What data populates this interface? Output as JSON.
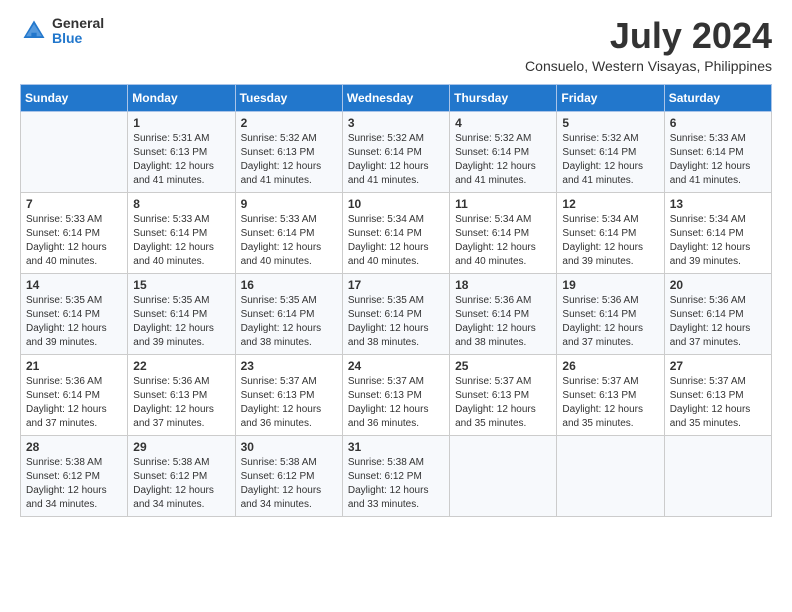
{
  "logo": {
    "general": "General",
    "blue": "Blue"
  },
  "title": "July 2024",
  "location": "Consuelo, Western Visayas, Philippines",
  "weekdays": [
    "Sunday",
    "Monday",
    "Tuesday",
    "Wednesday",
    "Thursday",
    "Friday",
    "Saturday"
  ],
  "weeks": [
    [
      {
        "day": "",
        "sunrise": "",
        "sunset": "",
        "daylight": ""
      },
      {
        "day": "1",
        "sunrise": "Sunrise: 5:31 AM",
        "sunset": "Sunset: 6:13 PM",
        "daylight": "Daylight: 12 hours and 41 minutes."
      },
      {
        "day": "2",
        "sunrise": "Sunrise: 5:32 AM",
        "sunset": "Sunset: 6:13 PM",
        "daylight": "Daylight: 12 hours and 41 minutes."
      },
      {
        "day": "3",
        "sunrise": "Sunrise: 5:32 AM",
        "sunset": "Sunset: 6:14 PM",
        "daylight": "Daylight: 12 hours and 41 minutes."
      },
      {
        "day": "4",
        "sunrise": "Sunrise: 5:32 AM",
        "sunset": "Sunset: 6:14 PM",
        "daylight": "Daylight: 12 hours and 41 minutes."
      },
      {
        "day": "5",
        "sunrise": "Sunrise: 5:32 AM",
        "sunset": "Sunset: 6:14 PM",
        "daylight": "Daylight: 12 hours and 41 minutes."
      },
      {
        "day": "6",
        "sunrise": "Sunrise: 5:33 AM",
        "sunset": "Sunset: 6:14 PM",
        "daylight": "Daylight: 12 hours and 41 minutes."
      }
    ],
    [
      {
        "day": "7",
        "sunrise": "Sunrise: 5:33 AM",
        "sunset": "Sunset: 6:14 PM",
        "daylight": "Daylight: 12 hours and 40 minutes."
      },
      {
        "day": "8",
        "sunrise": "Sunrise: 5:33 AM",
        "sunset": "Sunset: 6:14 PM",
        "daylight": "Daylight: 12 hours and 40 minutes."
      },
      {
        "day": "9",
        "sunrise": "Sunrise: 5:33 AM",
        "sunset": "Sunset: 6:14 PM",
        "daylight": "Daylight: 12 hours and 40 minutes."
      },
      {
        "day": "10",
        "sunrise": "Sunrise: 5:34 AM",
        "sunset": "Sunset: 6:14 PM",
        "daylight": "Daylight: 12 hours and 40 minutes."
      },
      {
        "day": "11",
        "sunrise": "Sunrise: 5:34 AM",
        "sunset": "Sunset: 6:14 PM",
        "daylight": "Daylight: 12 hours and 40 minutes."
      },
      {
        "day": "12",
        "sunrise": "Sunrise: 5:34 AM",
        "sunset": "Sunset: 6:14 PM",
        "daylight": "Daylight: 12 hours and 39 minutes."
      },
      {
        "day": "13",
        "sunrise": "Sunrise: 5:34 AM",
        "sunset": "Sunset: 6:14 PM",
        "daylight": "Daylight: 12 hours and 39 minutes."
      }
    ],
    [
      {
        "day": "14",
        "sunrise": "Sunrise: 5:35 AM",
        "sunset": "Sunset: 6:14 PM",
        "daylight": "Daylight: 12 hours and 39 minutes."
      },
      {
        "day": "15",
        "sunrise": "Sunrise: 5:35 AM",
        "sunset": "Sunset: 6:14 PM",
        "daylight": "Daylight: 12 hours and 39 minutes."
      },
      {
        "day": "16",
        "sunrise": "Sunrise: 5:35 AM",
        "sunset": "Sunset: 6:14 PM",
        "daylight": "Daylight: 12 hours and 38 minutes."
      },
      {
        "day": "17",
        "sunrise": "Sunrise: 5:35 AM",
        "sunset": "Sunset: 6:14 PM",
        "daylight": "Daylight: 12 hours and 38 minutes."
      },
      {
        "day": "18",
        "sunrise": "Sunrise: 5:36 AM",
        "sunset": "Sunset: 6:14 PM",
        "daylight": "Daylight: 12 hours and 38 minutes."
      },
      {
        "day": "19",
        "sunrise": "Sunrise: 5:36 AM",
        "sunset": "Sunset: 6:14 PM",
        "daylight": "Daylight: 12 hours and 37 minutes."
      },
      {
        "day": "20",
        "sunrise": "Sunrise: 5:36 AM",
        "sunset": "Sunset: 6:14 PM",
        "daylight": "Daylight: 12 hours and 37 minutes."
      }
    ],
    [
      {
        "day": "21",
        "sunrise": "Sunrise: 5:36 AM",
        "sunset": "Sunset: 6:14 PM",
        "daylight": "Daylight: 12 hours and 37 minutes."
      },
      {
        "day": "22",
        "sunrise": "Sunrise: 5:36 AM",
        "sunset": "Sunset: 6:13 PM",
        "daylight": "Daylight: 12 hours and 37 minutes."
      },
      {
        "day": "23",
        "sunrise": "Sunrise: 5:37 AM",
        "sunset": "Sunset: 6:13 PM",
        "daylight": "Daylight: 12 hours and 36 minutes."
      },
      {
        "day": "24",
        "sunrise": "Sunrise: 5:37 AM",
        "sunset": "Sunset: 6:13 PM",
        "daylight": "Daylight: 12 hours and 36 minutes."
      },
      {
        "day": "25",
        "sunrise": "Sunrise: 5:37 AM",
        "sunset": "Sunset: 6:13 PM",
        "daylight": "Daylight: 12 hours and 35 minutes."
      },
      {
        "day": "26",
        "sunrise": "Sunrise: 5:37 AM",
        "sunset": "Sunset: 6:13 PM",
        "daylight": "Daylight: 12 hours and 35 minutes."
      },
      {
        "day": "27",
        "sunrise": "Sunrise: 5:37 AM",
        "sunset": "Sunset: 6:13 PM",
        "daylight": "Daylight: 12 hours and 35 minutes."
      }
    ],
    [
      {
        "day": "28",
        "sunrise": "Sunrise: 5:38 AM",
        "sunset": "Sunset: 6:12 PM",
        "daylight": "Daylight: 12 hours and 34 minutes."
      },
      {
        "day": "29",
        "sunrise": "Sunrise: 5:38 AM",
        "sunset": "Sunset: 6:12 PM",
        "daylight": "Daylight: 12 hours and 34 minutes."
      },
      {
        "day": "30",
        "sunrise": "Sunrise: 5:38 AM",
        "sunset": "Sunset: 6:12 PM",
        "daylight": "Daylight: 12 hours and 34 minutes."
      },
      {
        "day": "31",
        "sunrise": "Sunrise: 5:38 AM",
        "sunset": "Sunset: 6:12 PM",
        "daylight": "Daylight: 12 hours and 33 minutes."
      },
      {
        "day": "",
        "sunrise": "",
        "sunset": "",
        "daylight": ""
      },
      {
        "day": "",
        "sunrise": "",
        "sunset": "",
        "daylight": ""
      },
      {
        "day": "",
        "sunrise": "",
        "sunset": "",
        "daylight": ""
      }
    ]
  ]
}
